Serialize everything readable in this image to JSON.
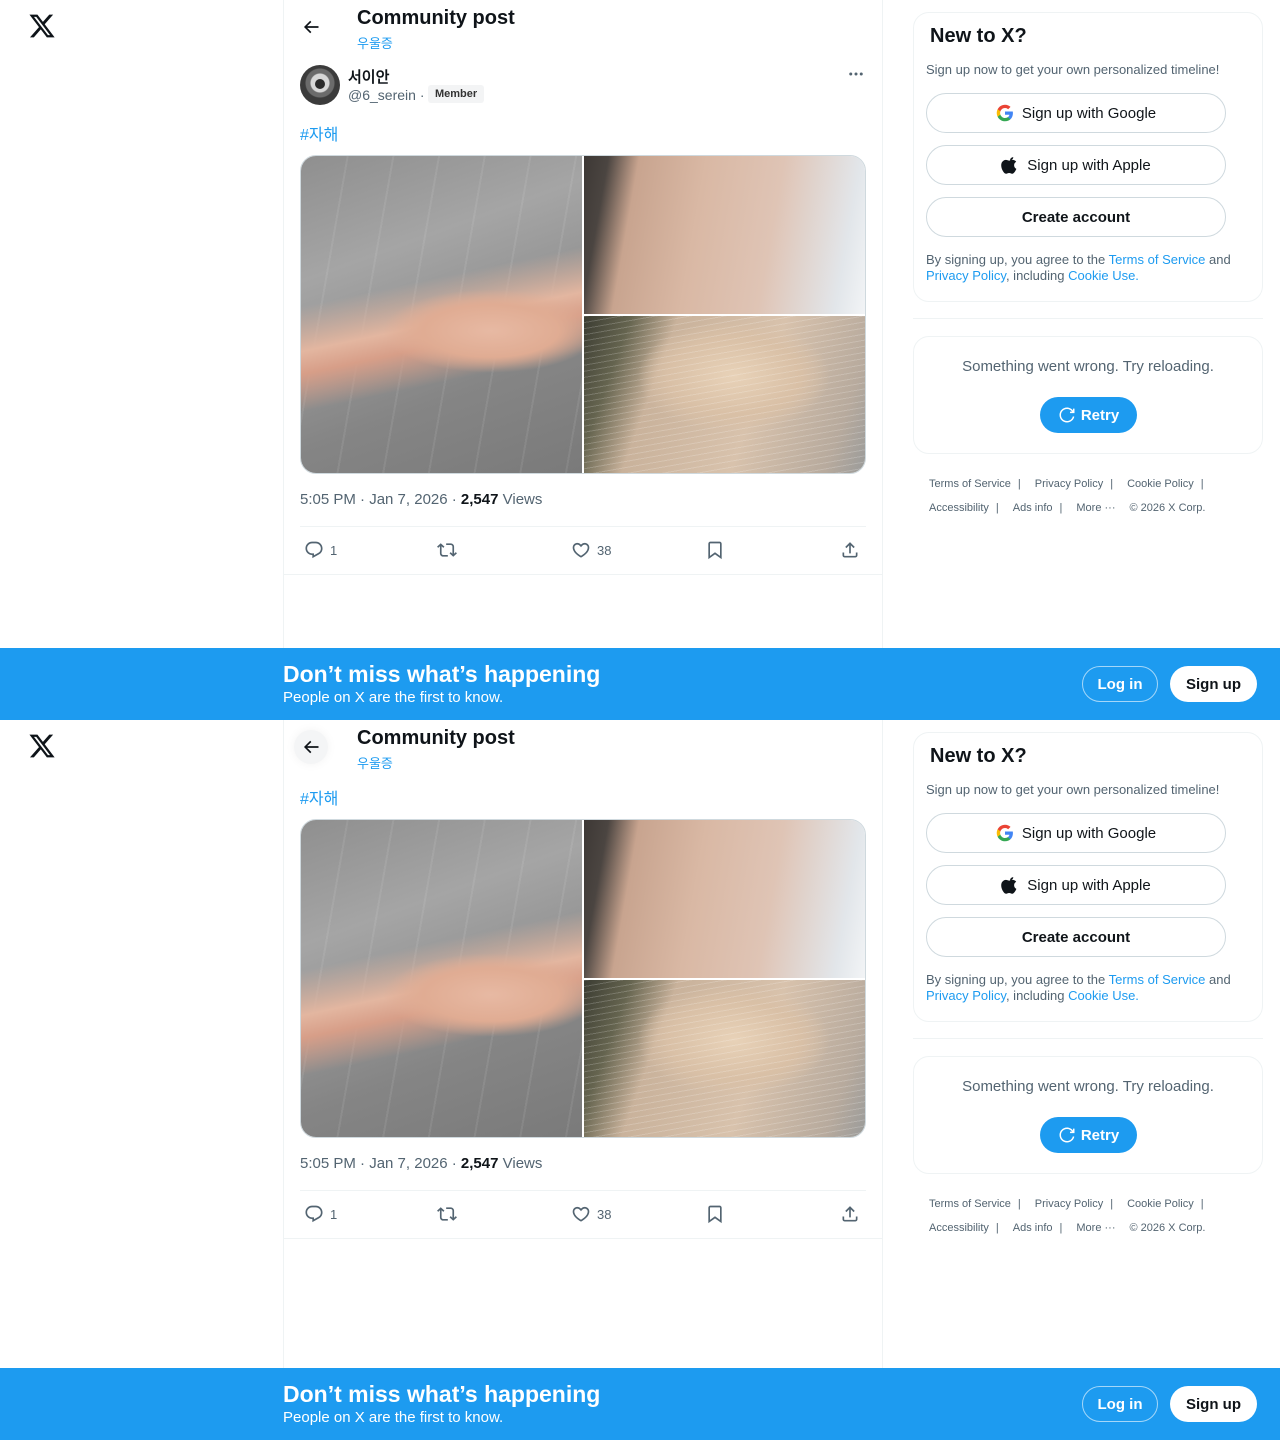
{
  "header": {
    "title": "Community post",
    "community": "우울증"
  },
  "post": {
    "author_name": "서이안",
    "author_handle": "@6_serein",
    "separator": "·",
    "member_badge": "Member",
    "hashtag": "#자해",
    "time": "5:05 PM · Jan 7, 2026 · ",
    "views_count": "2,547",
    "views_label": " Views",
    "replies": "1",
    "likes": "38",
    "images": [
      "arm-photo-1",
      "arm-photo-2",
      "arm-photo-3"
    ]
  },
  "sidebar": {
    "title": "New to X?",
    "subtitle": "Sign up now to get your own personalized timeline!",
    "google_label": "Sign up with Google",
    "apple_label": "Sign up with Apple",
    "create_label": "Create account",
    "terms_prefix": "By signing up, you agree to the ",
    "terms_link": "Terms of Service",
    "terms_and": " and ",
    "privacy_link": "Privacy Policy",
    "terms_including": ", including ",
    "cookie_link": "Cookie Use.",
    "error_text": "Something went wrong. Try reloading.",
    "retry_label": "Retry"
  },
  "footer": {
    "terms": "Terms of Service",
    "privacy": "Privacy Policy",
    "cookie": "Cookie Policy",
    "accessibility": "Accessibility",
    "ads": "Ads info",
    "more": "More ···",
    "copyright": "© 2026 X Corp.",
    "sep": "|"
  },
  "banner": {
    "title": "Don’t miss what’s happening",
    "subtitle": "People on X are the first to know.",
    "login": "Log in",
    "signup": "Sign up"
  },
  "colors": {
    "accent": "#1d9bf0",
    "text": "#0f1419",
    "muted": "#536471",
    "border": "#eff3f4"
  },
  "icons": [
    "x-logo-icon",
    "back-arrow-icon",
    "more-icon",
    "reply-icon",
    "retweet-icon",
    "like-icon",
    "bookmark-icon",
    "share-icon",
    "google-icon",
    "apple-icon",
    "refresh-icon"
  ]
}
